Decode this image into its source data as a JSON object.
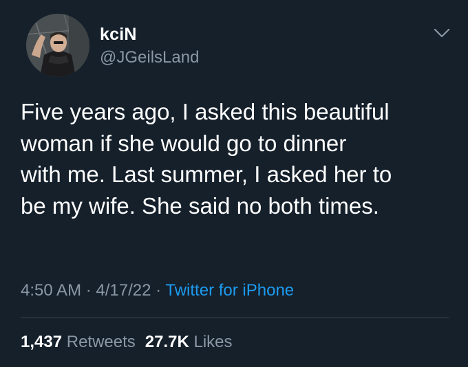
{
  "user": {
    "display_name": "kciN",
    "handle": "@JGeilsLand"
  },
  "tweet": {
    "lines": [
      "Five years ago, I asked this beautiful",
      "woman if she would go to dinner",
      "with me. Last summer, I asked her to",
      "be my wife. She said no both times."
    ],
    "time": "4:50 AM",
    "date": "4/17/22",
    "separator": "·",
    "source": "Twitter for iPhone"
  },
  "stats": {
    "retweets_count": "1,437",
    "retweets_label": "Retweets",
    "likes_count": "27.7K",
    "likes_label": "Likes"
  },
  "icons": {
    "menu": "chevron-down-icon"
  },
  "colors": {
    "background": "#15202b",
    "primary_text": "#ffffff",
    "secondary_text": "#8b98a5",
    "link": "#1d9bf0",
    "divider": "#38444d"
  }
}
